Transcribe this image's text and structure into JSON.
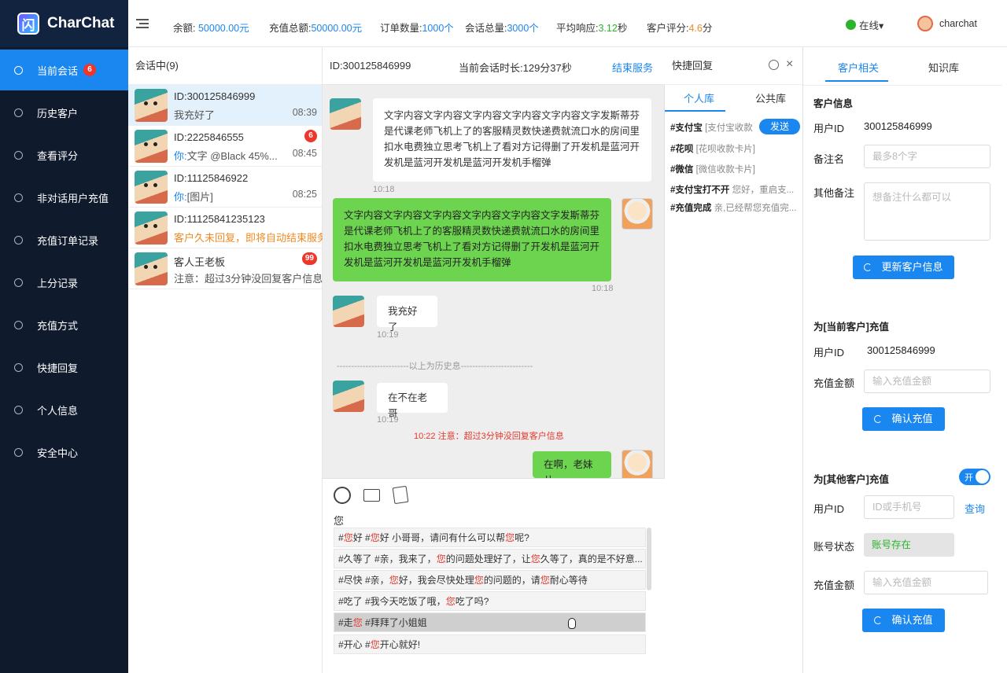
{
  "app": {
    "name": "CharChat",
    "logo_letter": "闪"
  },
  "sidebar": {
    "items": [
      {
        "label": "当前会话",
        "badge": "6"
      },
      {
        "label": "历史客户"
      },
      {
        "label": "查看评分"
      },
      {
        "label": "非对话用户充值"
      },
      {
        "label": "充值订单记录"
      },
      {
        "label": "上分记录"
      },
      {
        "label": "充值方式"
      },
      {
        "label": "快捷回复"
      },
      {
        "label": "个人信息"
      },
      {
        "label": "安全中心"
      }
    ]
  },
  "topbar": {
    "balance_label": "余额:",
    "balance": "50000.00元",
    "recharge_label": "充值总额:",
    "recharge": "50000.00元",
    "orders_label": "订单数量:",
    "orders": "1000个",
    "sessions_label": "会话总量:",
    "sessions": "3000个",
    "response_label": "平均响应:",
    "response_value": "3.12",
    "response_unit": "秒",
    "rating_label": "客户评分:",
    "rating_value": "4.6",
    "rating_unit": "分",
    "status": "在线▾",
    "username": "charchat"
  },
  "session_list": {
    "header": "会话中(9)",
    "items": [
      {
        "id": "ID:300125846999",
        "msg": "我充好了",
        "time": "08:39"
      },
      {
        "id": "ID:2225846555",
        "prefix": "你:",
        "msg": "文字 @Black 45%...",
        "time": "08:45",
        "badge": "6"
      },
      {
        "id": "ID:11125846922",
        "prefix": "你:",
        "msg": "[图片]",
        "time": "08:25"
      },
      {
        "id": "ID:11125841235123",
        "msg": "客户久未回复，即将自动结束服务"
      },
      {
        "id": "客人王老板",
        "msg": "注意：超过3分钟没回复客户信息",
        "badge": "99"
      }
    ]
  },
  "chat": {
    "header_id": "ID:300125846999",
    "duration": "当前会话时长:129分37秒",
    "end_button": "结束服务",
    "messages": [
      {
        "text": "文字内容文字内容文字内容文字内容文字内容文字发斯蒂芬是代课老师飞机上了的客服精灵数快递费就流口水的房间里扣水电费独立思考飞机上了看对方记得删了开发机是蓝河开发机是蓝河开发机是蓝河开发机手榴弹",
        "time": "10:18"
      },
      {
        "text": "文字内容文字内容文字内容文字内容文字内容文字发斯蒂芬是代课老师飞机上了的客服精灵数快递费就流口水的房间里扣水电费独立思考飞机上了看对方记得删了开发机是蓝河开发机是蓝河开发机是蓝河开发机手榴弹",
        "time": "10:18"
      },
      {
        "text": "我充好了",
        "time": "10:19"
      },
      {
        "text": "在不在老哥",
        "time": "10:19"
      },
      {
        "text": "在啊，老妹儿"
      }
    ],
    "history_divider": "-------------------------以上为历史息-------------------------",
    "warning": "10:22 注意：超过3分钟没回复客户信息",
    "input_text": "您",
    "quick_replies": [
      {
        "p1": "#",
        "h1": "您",
        "p2": "好  #",
        "h2": "您",
        "p3": "好 小哥哥，请问有什么可以帮",
        "h3": "您",
        "p4": "呢?"
      },
      {
        "p1": "#久等了  #亲，我来了，",
        "h1": "您",
        "p2": "的问题处理好了，让",
        "h2": "您",
        "p3": "久等了，真的是不好意...",
        "h3": "",
        "p4": ""
      },
      {
        "p1": "#尽快  #亲，",
        "h1": "您",
        "p2": "好，我会尽快处理",
        "h2": "您",
        "p3": "的问题的，请",
        "h3": "您",
        "p4": "耐心等待"
      },
      {
        "p1": "#吃了  #我今天吃饭了哦，",
        "h1": "您",
        "p2": "吃了吗?",
        "h2": "",
        "p3": "",
        "h3": "",
        "p4": ""
      },
      {
        "p1": "#走",
        "h1": "您",
        "p2": "  #拜拜了小姐姐",
        "h2": "",
        "p3": "",
        "h3": "",
        "p4": ""
      },
      {
        "p1": "#开心  #",
        "h1": "您",
        "p2": "开心就好!",
        "h2": "",
        "p3": "",
        "h3": "",
        "p4": ""
      }
    ]
  },
  "quick_reply": {
    "title": "快捷回复",
    "tabs": [
      "个人库",
      "公共库"
    ],
    "send": "发送",
    "items": [
      {
        "key": "#支付宝",
        "desc": "[支付宝收款"
      },
      {
        "key": "#花呗",
        "desc": "[花呗收款卡片]"
      },
      {
        "key": "#微信",
        "desc": "[微信收款卡片]"
      },
      {
        "key": "#支付宝打不开",
        "desc": "您好，重启支..."
      },
      {
        "key": "#充值完成",
        "desc": "亲,已经帮您充值完..."
      }
    ]
  },
  "customer": {
    "tabs": [
      "客户相关",
      "知识库"
    ],
    "info_title": "客户信息",
    "user_id_label": "用户ID",
    "user_id": "300125846999",
    "remark_label": "备注名",
    "remark_placeholder": "最多8个字",
    "other_label": "其他备注",
    "other_placeholder": "想备注什么都可以",
    "update_button": "更新客户信息",
    "current_title": "为[当前客户]充值",
    "current_user_id": "300125846999",
    "amount_label": "充值金额",
    "amount_placeholder": "输入充值金额",
    "confirm_button": "确认充值",
    "other_title": "为[其他客户]充值",
    "toggle": "开",
    "other_id_placeholder": "ID或手机号",
    "query": "查询",
    "account_label": "账号状态",
    "account_status": "账号存在"
  }
}
